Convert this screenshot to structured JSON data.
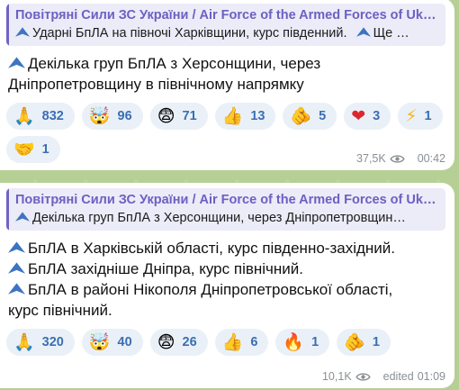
{
  "messages": [
    {
      "quote": {
        "author": "Повітряні Сили ЗС України / Air Force of the Armed Forces of Ukr…",
        "text": "Ударні БпЛА на півночі Харківщини, курс південний.",
        "text_tail": "Ще …"
      },
      "lines": [
        "Декілька груп БпЛА з Херсонщини, через",
        "Дніпропетровщину в північному напрямку"
      ],
      "reactions": [
        {
          "icon": "folded-hands",
          "emoji": "🙏",
          "count": "832"
        },
        {
          "icon": "exploding-head",
          "emoji": "🤯",
          "count": "96"
        },
        {
          "icon": "fearful-face",
          "emoji": "😨",
          "count": "71"
        },
        {
          "icon": "thumbs-up",
          "emoji": "👍",
          "count": "13"
        },
        {
          "icon": "pointing-hand",
          "emoji": "🫵",
          "count": "5"
        },
        {
          "icon": "red-heart",
          "emoji": "❤",
          "count": "3"
        },
        {
          "icon": "lightning",
          "emoji": "⚡",
          "count": "1"
        },
        {
          "icon": "handshake",
          "emoji": "🤝",
          "count": "1"
        }
      ],
      "views": "37,5K",
      "time": "00:42"
    },
    {
      "quote": {
        "author": "Повітряні Сили ЗС України / Air Force of the Armed Forces of Ukr…",
        "text": "Декілька груп БпЛА з Херсонщини, через Дніпропетровщин…"
      },
      "lines": [
        "БпЛА в Харківській області, курс південно-західний.",
        "БпЛА західніше Дніпра, курс північний.",
        "БпЛА в районі Нікополя Дніпропетровської області,",
        "курс північний."
      ],
      "reactions": [
        {
          "icon": "folded-hands",
          "emoji": "🙏",
          "count": "320"
        },
        {
          "icon": "exploding-head",
          "emoji": "🤯",
          "count": "40"
        },
        {
          "icon": "fearful-face",
          "emoji": "😨",
          "count": "26"
        },
        {
          "icon": "thumbs-up",
          "emoji": "👍",
          "count": "6"
        },
        {
          "icon": "fire",
          "emoji": "🔥",
          "count": "1"
        },
        {
          "icon": "pointing-hand",
          "emoji": "🫵",
          "count": "1"
        }
      ],
      "views": "10,1K",
      "edited": "edited",
      "time": "01:09"
    }
  ],
  "colors": {
    "background": "#b5cf95",
    "bubble": "#ffffff",
    "quote_bar": "#6f63c5",
    "quote_author": "#6c60c2",
    "reaction_pill": "#eaf0f7",
    "reaction_count": "#3a6fb2",
    "plane_icon": "#3d74c2",
    "meta_text": "#8a8f94"
  }
}
